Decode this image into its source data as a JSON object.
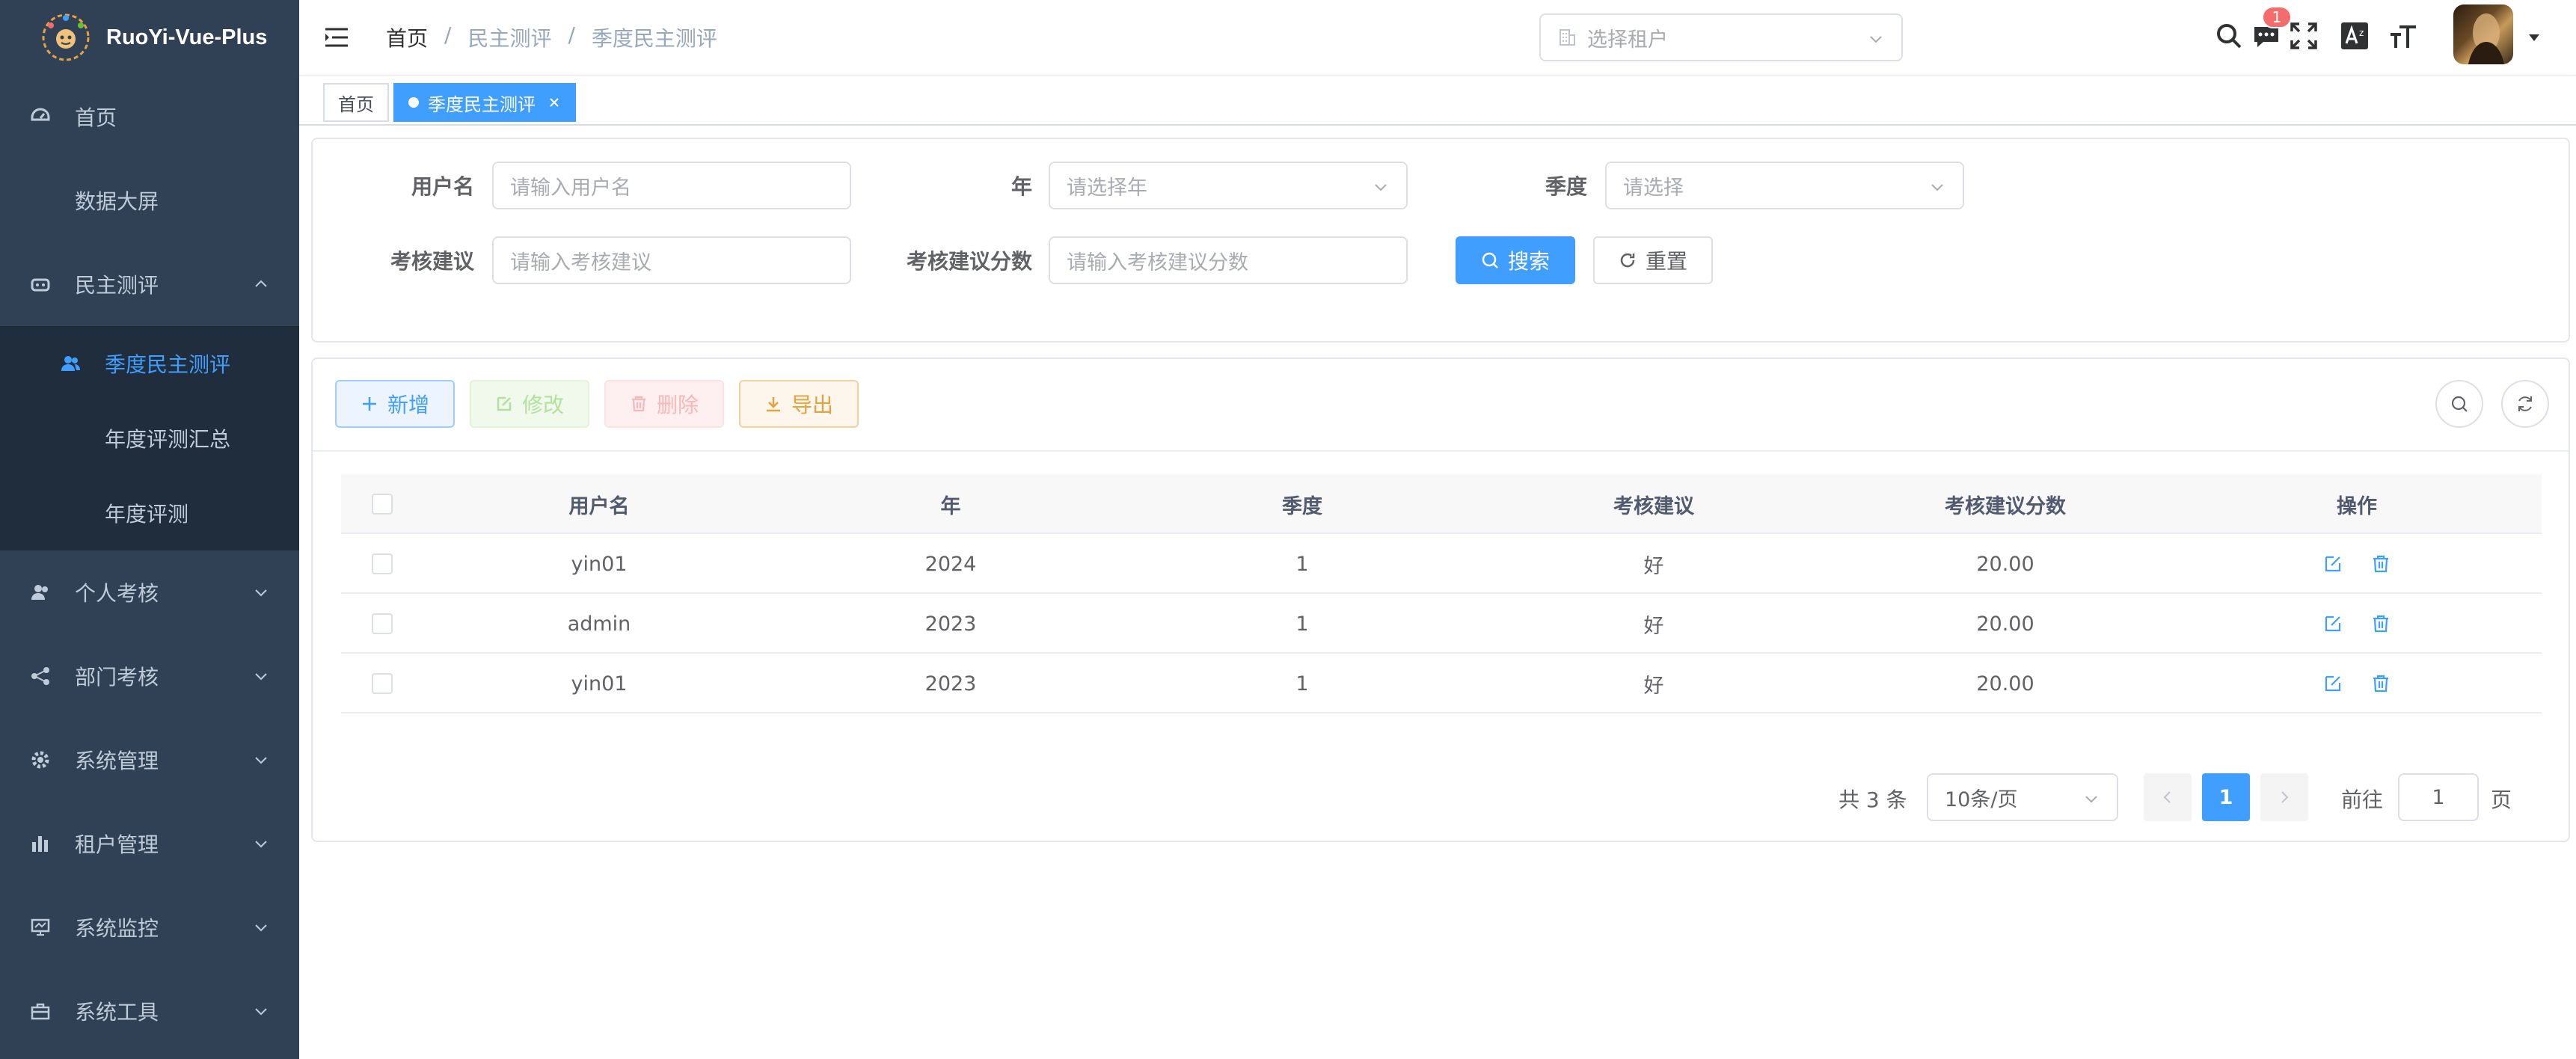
{
  "app": {
    "name": "RuoYi-Vue-Plus"
  },
  "sidebar": {
    "items": [
      {
        "label": "首页",
        "icon": "dashboard-icon"
      },
      {
        "label": "数据大屏"
      },
      {
        "label": "民主测评",
        "icon": "eval-icon",
        "expanded": true
      },
      {
        "label": "季度民主测评",
        "icon": "people-icon",
        "active": true
      },
      {
        "label": "年度评测汇总"
      },
      {
        "label": "年度评测"
      },
      {
        "label": "个人考核",
        "icon": "person-icon"
      },
      {
        "label": "部门考核",
        "icon": "tree-icon"
      },
      {
        "label": "系统管理",
        "icon": "gear-icon"
      },
      {
        "label": "租户管理",
        "icon": "chart-icon"
      },
      {
        "label": "系统监控",
        "icon": "monitor-icon"
      },
      {
        "label": "系统工具",
        "icon": "toolbox-icon"
      }
    ]
  },
  "header": {
    "breadcrumb": [
      "首页",
      "/",
      "民主测评",
      "/",
      "季度民主测评"
    ],
    "tenant_placeholder": "选择租户",
    "message_count": "1"
  },
  "tags": [
    {
      "label": "首页"
    },
    {
      "label": "季度民主测评",
      "active": true
    }
  ],
  "search_form": {
    "username_label": "用户名",
    "username_placeholder": "请输入用户名",
    "year_label": "年",
    "year_placeholder": "请选择年",
    "quarter_label": "季度",
    "quarter_placeholder": "请选择",
    "suggestion_label": "考核建议",
    "suggestion_placeholder": "请输入考核建议",
    "score_label": "考核建议分数",
    "score_placeholder": "请输入考核建议分数",
    "search_button": "搜索",
    "reset_button": "重置"
  },
  "toolbar": {
    "add": "新增",
    "edit": "修改",
    "delete": "删除",
    "export": "导出"
  },
  "table": {
    "columns": [
      "用户名",
      "年",
      "季度",
      "考核建议",
      "考核建议分数",
      "操作"
    ],
    "rows": [
      {
        "username": "yin01",
        "year": "2024",
        "quarter": "1",
        "suggestion": "好",
        "score": "20.00"
      },
      {
        "username": "admin",
        "year": "2023",
        "quarter": "1",
        "suggestion": "好",
        "score": "20.00"
      },
      {
        "username": "yin01",
        "year": "2023",
        "quarter": "1",
        "suggestion": "好",
        "score": "20.00"
      }
    ]
  },
  "pagination": {
    "total": "共 3 条",
    "page_size": "10条/页",
    "current_page": "1",
    "goto_label": "前往",
    "goto_value": "1",
    "page_unit": "页"
  },
  "colors": {
    "sidebar_bg": "#304156",
    "submenu_bg": "#1f2d3d",
    "primary": "#409eff",
    "danger": "#f56c6c",
    "warning": "#e6a23c",
    "success": "#67c23a"
  }
}
